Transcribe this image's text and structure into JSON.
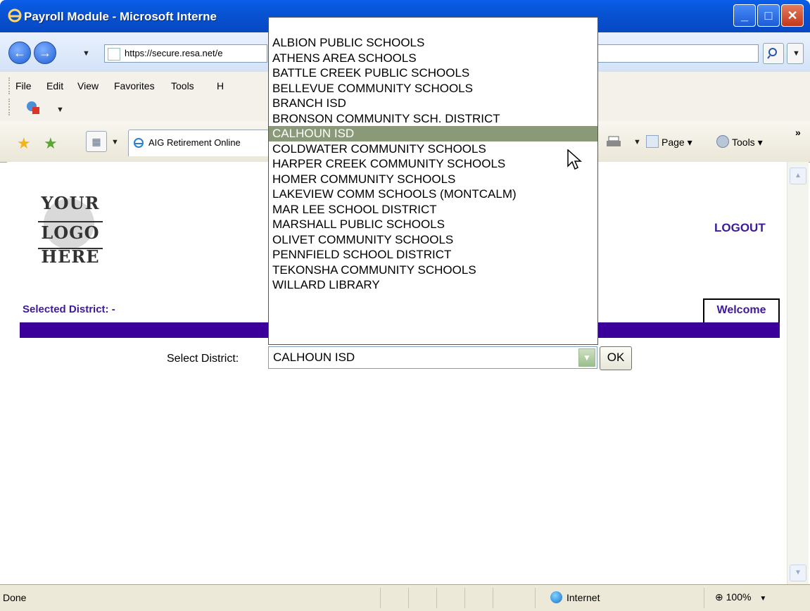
{
  "window": {
    "title": "Payroll Module - Microsoft Interne",
    "controls": {
      "minimize": "_",
      "maximize": "□",
      "close": "✕"
    }
  },
  "address_bar": {
    "url": "https://secure.resa.net/e"
  },
  "menu": {
    "items": [
      "File",
      "Edit",
      "View",
      "Favorites",
      "Tools",
      "H"
    ]
  },
  "tabs": {
    "active": "AIG Retirement Online"
  },
  "command_bar": {
    "page": "Page ▾",
    "tools": "Tools ▾",
    "more": "»"
  },
  "page": {
    "logo": {
      "line1": "YOUR",
      "line2": "LOGO",
      "line3": "HERE"
    },
    "logout": "LOGOUT",
    "selected_district_label": "Selected District:  -",
    "welcome_tab": "Welcome",
    "select_district_label": "Select District:",
    "select_value": "CALHOUN ISD",
    "ok_button": "OK"
  },
  "dropdown": {
    "options": [
      "ALBION PUBLIC SCHOOLS",
      "ATHENS AREA SCHOOLS",
      "BATTLE CREEK PUBLIC SCHOOLS",
      "BELLEVUE COMMUNITY SCHOOLS",
      "BRANCH ISD",
      "BRONSON COMMUNITY SCH. DISTRICT",
      "CALHOUN ISD",
      "COLDWATER COMMUNITY SCHOOLS",
      "HARPER CREEK COMMUNITY SCHOOLS",
      "HOMER COMMUNITY SCHOOLS",
      "LAKEVIEW COMM SCHOOLS (MONTCALM)",
      "MAR LEE SCHOOL DISTRICT",
      "MARSHALL PUBLIC SCHOOLS",
      "OLIVET COMMUNITY SCHOOLS",
      "PENNFIELD SCHOOL DISTRICT",
      "TEKONSHA COMMUNITY SCHOOLS",
      "WILLARD LIBRARY"
    ],
    "highlighted_index": 6
  },
  "status_bar": {
    "text": "Done",
    "zone": "Internet",
    "zoom": "100%"
  },
  "colors": {
    "brand_purple": "#3a0099",
    "link_purple": "#3d1a9a",
    "highlight": "#8a9a78"
  }
}
